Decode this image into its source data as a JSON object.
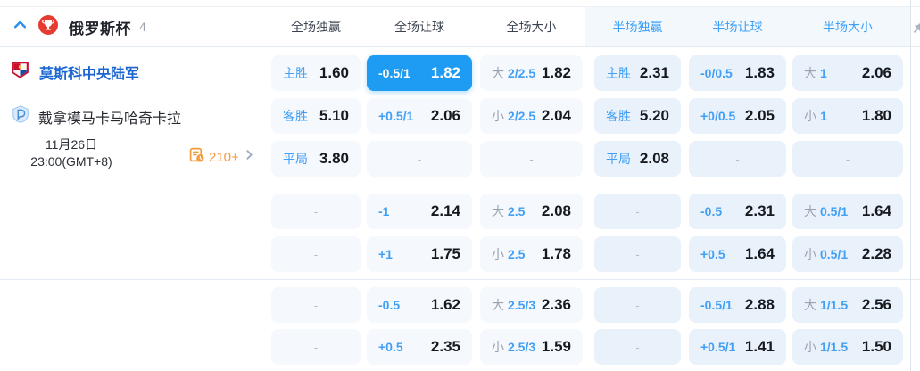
{
  "colors": {
    "accent_blue": "#41a0f6",
    "selected_cell_bg": "#1e9bf2",
    "team_link_blue": "#1b66d1",
    "side_gray": "#9aa3af",
    "more_orange": "#f59a3d",
    "cell_bg_full": "#f5f8fc",
    "cell_bg_half": "#e9f1fb"
  },
  "icons": {
    "collapse": "chevron-up-icon",
    "league": "trophy-icon",
    "home_team": "cska-crest-icon",
    "away_team": "dynamo-crest-icon",
    "more_markets": "schedule-clock-icon",
    "more_chevron": "chevron-right-icon",
    "corner": "pin-icon"
  },
  "league_header": {
    "title": "俄罗斯杯",
    "count": "4",
    "columns": [
      {
        "label": "全场独赢",
        "scope": "full"
      },
      {
        "label": "全场让球",
        "scope": "full"
      },
      {
        "label": "全场大小",
        "scope": "full"
      },
      {
        "label": "半场独赢",
        "scope": "half"
      },
      {
        "label": "半场让球",
        "scope": "half"
      },
      {
        "label": "半场大小",
        "scope": "half"
      }
    ]
  },
  "match": {
    "home": {
      "name": "莫斯科中央陆军"
    },
    "away": {
      "name": "戴拿模马卡马哈奇卡拉"
    },
    "date_line1": "11月26日",
    "date_line2": "23:00(GMT+8)",
    "more_markets": "210+"
  },
  "odds": {
    "rows": [
      [
        {
          "label": "主胜",
          "value": "1.60"
        },
        {
          "hcp": "-0.5/1",
          "value": "1.82",
          "selected": true
        },
        {
          "side": "大",
          "line": "2/2.5",
          "value": "1.82"
        },
        {
          "label": "主胜",
          "value": "2.31"
        },
        {
          "hcp": "-0/0.5",
          "value": "1.83"
        },
        {
          "side": "大",
          "line": "1",
          "value": "2.06"
        }
      ],
      [
        {
          "label": "客胜",
          "value": "5.10"
        },
        {
          "hcp": "+0.5/1",
          "value": "2.06"
        },
        {
          "side": "小",
          "line": "2/2.5",
          "value": "2.04"
        },
        {
          "label": "客胜",
          "value": "5.20"
        },
        {
          "hcp": "+0/0.5",
          "value": "2.05"
        },
        {
          "side": "小",
          "line": "1",
          "value": "1.80"
        }
      ],
      [
        {
          "label": "平局",
          "value": "3.80"
        },
        {
          "empty": true
        },
        {
          "empty": true
        },
        {
          "label": "平局",
          "value": "2.08"
        },
        {
          "empty": true
        },
        {
          "empty": true
        }
      ],
      [
        {
          "empty": true
        },
        {
          "hcp": "-1",
          "value": "2.14"
        },
        {
          "side": "大",
          "line": "2.5",
          "value": "2.08"
        },
        {
          "empty": true
        },
        {
          "hcp": "-0.5",
          "value": "2.31"
        },
        {
          "side": "大",
          "line": "0.5/1",
          "value": "1.64"
        }
      ],
      [
        {
          "empty": true
        },
        {
          "hcp": "+1",
          "value": "1.75"
        },
        {
          "side": "小",
          "line": "2.5",
          "value": "1.78"
        },
        {
          "empty": true
        },
        {
          "hcp": "+0.5",
          "value": "1.64"
        },
        {
          "side": "小",
          "line": "0.5/1",
          "value": "2.28"
        }
      ],
      [
        {
          "empty": true
        },
        {
          "hcp": "-0.5",
          "value": "1.62"
        },
        {
          "side": "大",
          "line": "2.5/3",
          "value": "2.36"
        },
        {
          "empty": true
        },
        {
          "hcp": "-0.5/1",
          "value": "2.88"
        },
        {
          "side": "大",
          "line": "1/1.5",
          "value": "2.56"
        }
      ],
      [
        {
          "empty": true
        },
        {
          "hcp": "+0.5",
          "value": "2.35"
        },
        {
          "side": "小",
          "line": "2.5/3",
          "value": "1.59"
        },
        {
          "empty": true
        },
        {
          "hcp": "+0.5/1",
          "value": "1.41"
        },
        {
          "side": "小",
          "line": "1/1.5",
          "value": "1.50"
        }
      ]
    ]
  }
}
